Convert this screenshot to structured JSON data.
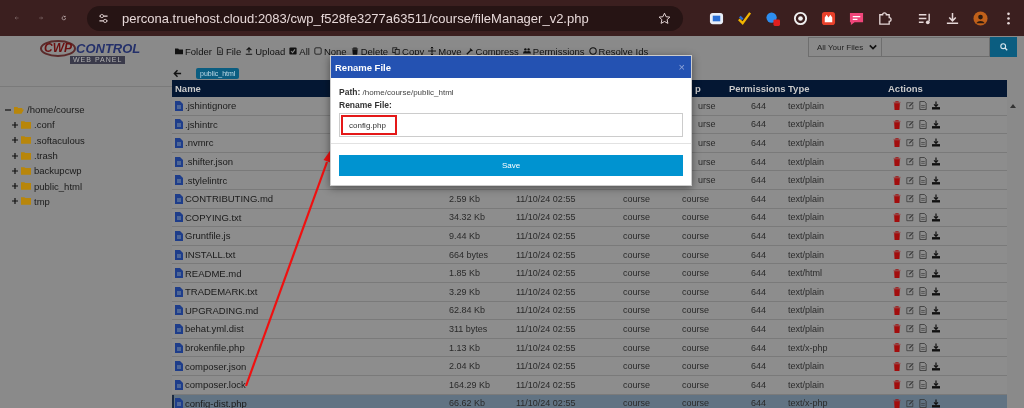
{
  "browser": {
    "url": "percona.truehost.cloud:2083/cwp_f528fe3277a63511/course/fileManager_v2.php"
  },
  "logo": {
    "mark": "CWP",
    "name": "CONTROL",
    "tagline": "WEB PANEL"
  },
  "toolbar": [
    "Folder",
    "File",
    "Upload",
    "All",
    "None",
    "Delete",
    "Copy",
    "Move",
    "Compress",
    "Permissions",
    "Resolve Ids"
  ],
  "search": {
    "scope": "All Your Files"
  },
  "tree": {
    "label": "/home/course",
    "expanded": true,
    "children": [
      {
        "label": ".conf",
        "expanded": false
      },
      {
        "label": ".softaculous",
        "expanded": false
      },
      {
        "label": ".trash",
        "expanded": false
      },
      {
        "label": "backupcwp",
        "expanded": false
      },
      {
        "label": "public_html",
        "expanded": false
      },
      {
        "label": "tmp",
        "expanded": false
      }
    ]
  },
  "breadcrumb": {
    "chip": "public_html"
  },
  "table": {
    "columns": [
      {
        "label": "Name"
      },
      {
        "label": "p"
      },
      {
        "label": "Permissions"
      },
      {
        "label": "Type"
      },
      {
        "label": "Actions"
      }
    ],
    "rows": [
      {
        "name": ".jshintignore",
        "group": "urse",
        "permissions": "644",
        "type": "text/plain",
        "selected": false
      },
      {
        "name": ".jshintrc",
        "group": "urse",
        "permissions": "644",
        "type": "text/plain",
        "selected": false
      },
      {
        "name": ".nvmrc",
        "group": "urse",
        "permissions": "644",
        "type": "text/plain",
        "selected": false
      },
      {
        "name": ".shifter.json",
        "group": "urse",
        "permissions": "644",
        "type": "text/plain",
        "selected": false
      },
      {
        "name": ".stylelintrc",
        "group": "urse",
        "permissions": "644",
        "type": "text/plain",
        "selected": false
      },
      {
        "name": "CONTRIBUTING.md",
        "size": "2.59 Kb",
        "date": "11/10/24 02:55",
        "owner": "course",
        "group": "course",
        "permissions": "644",
        "type": "text/plain",
        "selected": false
      },
      {
        "name": "COPYING.txt",
        "size": "34.32 Kb",
        "date": "11/10/24 02:55",
        "owner": "course",
        "group": "course",
        "permissions": "644",
        "type": "text/plain",
        "selected": false
      },
      {
        "name": "Gruntfile.js",
        "size": "9.44 Kb",
        "date": "11/10/24 02:55",
        "owner": "course",
        "group": "course",
        "permissions": "644",
        "type": "text/plain",
        "selected": false
      },
      {
        "name": "INSTALL.txt",
        "size": "664 bytes",
        "date": "11/10/24 02:55",
        "owner": "course",
        "group": "course",
        "permissions": "644",
        "type": "text/plain",
        "selected": false
      },
      {
        "name": "README.md",
        "size": "1.85 Kb",
        "date": "11/10/24 02:55",
        "owner": "course",
        "group": "course",
        "permissions": "644",
        "type": "text/html",
        "selected": false
      },
      {
        "name": "TRADEMARK.txt",
        "size": "3.29 Kb",
        "date": "11/10/24 02:55",
        "owner": "course",
        "group": "course",
        "permissions": "644",
        "type": "text/plain",
        "selected": false
      },
      {
        "name": "UPGRADING.md",
        "size": "62.84 Kb",
        "date": "11/10/24 02:55",
        "owner": "course",
        "group": "course",
        "permissions": "644",
        "type": "text/plain",
        "selected": false
      },
      {
        "name": "behat.yml.dist",
        "size": "311 bytes",
        "date": "11/10/24 02:55",
        "owner": "course",
        "group": "course",
        "permissions": "644",
        "type": "text/plain",
        "selected": false
      },
      {
        "name": "brokenfile.php",
        "size": "1.13 Kb",
        "date": "11/10/24 02:55",
        "owner": "course",
        "group": "course",
        "permissions": "644",
        "type": "text/x-php",
        "selected": false
      },
      {
        "name": "composer.json",
        "size": "2.04 Kb",
        "date": "11/10/24 02:55",
        "owner": "course",
        "group": "course",
        "permissions": "644",
        "type": "text/plain",
        "selected": false
      },
      {
        "name": "composer.lock",
        "size": "164.29 Kb",
        "date": "11/10/24 02:55",
        "owner": "course",
        "group": "course",
        "permissions": "644",
        "type": "text/plain",
        "selected": false
      },
      {
        "name": "config-dist.php",
        "size": "66.62 Kb",
        "date": "11/10/24 02:55",
        "owner": "course",
        "group": "course",
        "permissions": "644",
        "type": "text/x-php",
        "selected": true
      }
    ]
  },
  "modal": {
    "title": "Rename File",
    "close": "×",
    "path": "**Path:** /home/course/public_html",
    "field_label": "Rename File:",
    "value": "config.php",
    "button": "Save"
  }
}
